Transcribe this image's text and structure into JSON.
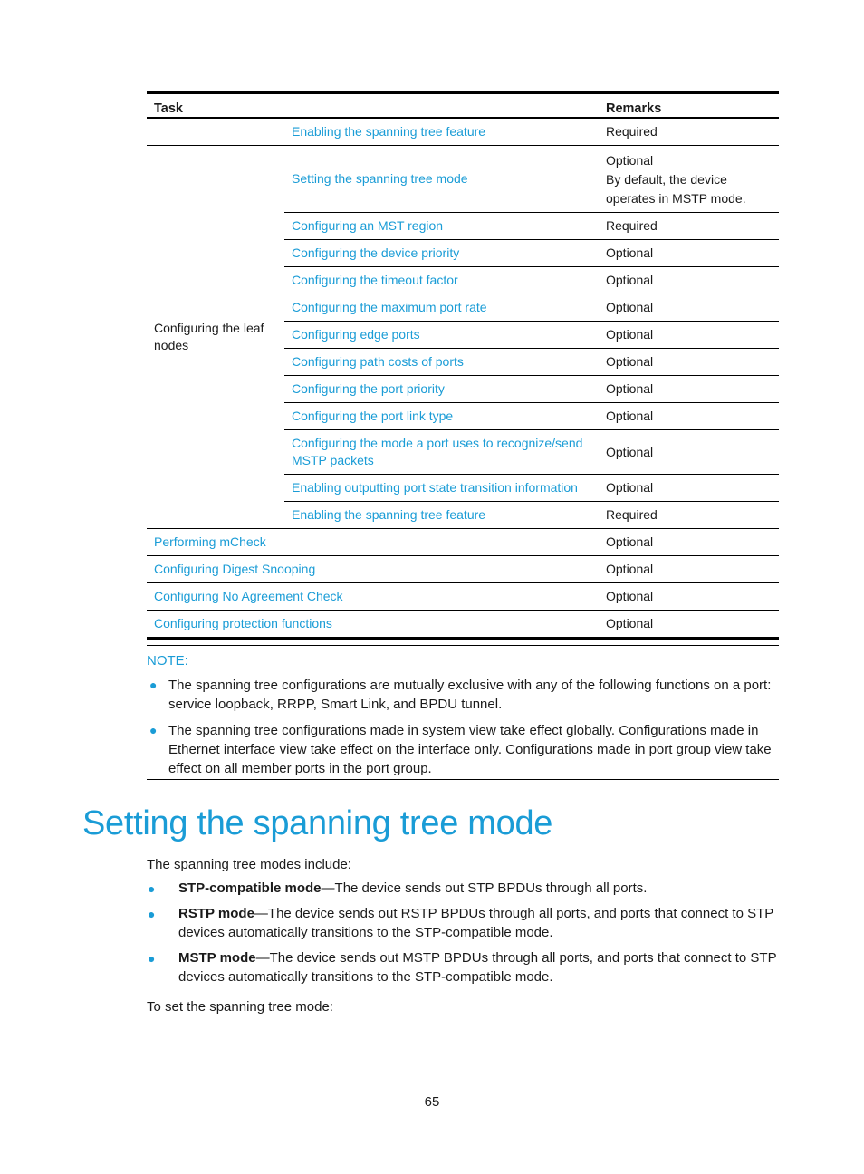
{
  "table": {
    "headers": {
      "task": "Task",
      "remarks": "Remarks"
    },
    "first_row": {
      "subtask": "Enabling the spanning tree feature",
      "remarks": "Required"
    },
    "group": {
      "label": "Configuring the leaf nodes",
      "rows": [
        {
          "subtask": "Setting the spanning tree mode",
          "remarks": "Optional",
          "remarks_note": "By default, the device operates in MSTP mode."
        },
        {
          "subtask": "Configuring an MST region",
          "remarks": "Required"
        },
        {
          "subtask": "Configuring the device priority",
          "remarks": "Optional"
        },
        {
          "subtask": "Configuring the timeout factor",
          "remarks": "Optional"
        },
        {
          "subtask": "Configuring the maximum port rate",
          "remarks": "Optional"
        },
        {
          "subtask": "Configuring edge ports",
          "remarks": "Optional"
        },
        {
          "subtask": "Configuring path costs of ports",
          "remarks": "Optional"
        },
        {
          "subtask": "Configuring the port priority",
          "remarks": "Optional"
        },
        {
          "subtask": "Configuring the port link type",
          "remarks": "Optional"
        },
        {
          "subtask": "Configuring the mode a port uses to recognize/send MSTP packets",
          "remarks": "Optional"
        },
        {
          "subtask": "Enabling outputting port state transition information",
          "remarks": "Optional"
        },
        {
          "subtask": "Enabling the spanning tree feature",
          "remarks": "Required"
        }
      ]
    },
    "trailing_rows": [
      {
        "task": "Performing mCheck",
        "remarks": "Optional"
      },
      {
        "task": "Configuring Digest Snooping",
        "remarks": "Optional"
      },
      {
        "task": "Configuring No Agreement Check",
        "remarks": "Optional"
      },
      {
        "task": "Configuring protection functions",
        "remarks": "Optional"
      }
    ]
  },
  "note": {
    "title": "NOTE:",
    "items": [
      "The spanning tree configurations are mutually exclusive with any of the following functions on a port: service loopback, RRPP, Smart Link, and BPDU tunnel.",
      "The spanning tree configurations made in system view take effect globally. Configurations made in Ethernet interface view take effect on the interface only. Configurations made in port group view take effect on all member ports in the port group."
    ]
  },
  "section": {
    "heading": "Setting the spanning tree mode",
    "intro": "The spanning tree modes include:",
    "modes": [
      {
        "name": "STP-compatible mode",
        "desc": "—The device sends out STP BPDUs through all ports."
      },
      {
        "name": "RSTP mode",
        "desc": "—The device sends out RSTP BPDUs through all ports, and ports that connect to STP devices automatically transitions to the STP-compatible mode."
      },
      {
        "name": "MSTP mode",
        "desc": "—The device sends out MSTP BPDUs through all ports, and ports that connect to STP devices automatically transitions to the STP-compatible mode."
      }
    ],
    "outro": "To set the spanning tree mode:"
  },
  "page_number": "65"
}
